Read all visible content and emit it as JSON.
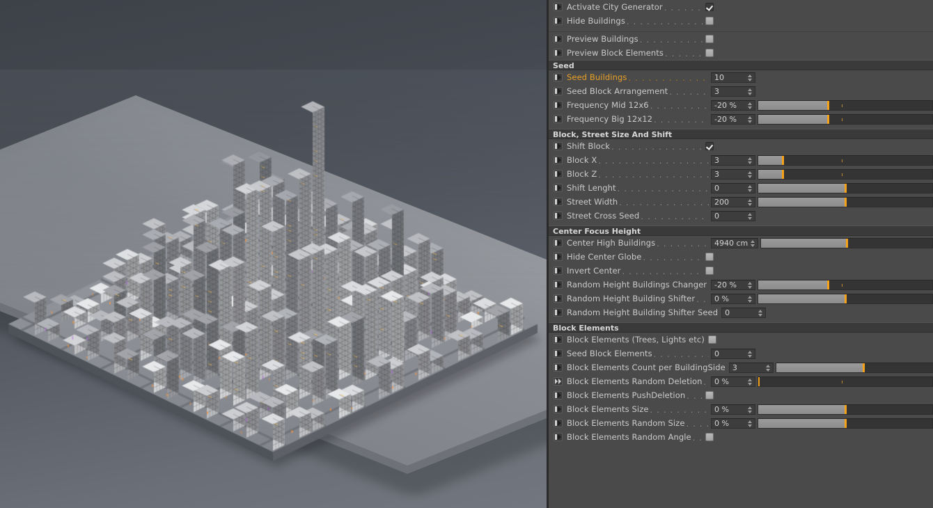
{
  "app": {
    "viewport_name": "3d-city-viewport"
  },
  "panel": {
    "groups": [
      {
        "type": "rows",
        "rows": [
          {
            "icon": "keyframe-icon",
            "label": "Activate City Generator",
            "dots": ". . . . . . . . . . . . .",
            "control": "checkbox",
            "value": "checked",
            "highlight": false
          },
          {
            "icon": "keyframe-icon",
            "label": "Hide Buildings",
            "dots": ". . . . . . . . . . . . . . . . . . .",
            "control": "checkbox",
            "value": "unchecked",
            "highlight": false
          }
        ]
      },
      {
        "type": "separator"
      },
      {
        "type": "rows",
        "rows": [
          {
            "icon": "keyframe-icon",
            "label": "Preview Buildings",
            "dots": ". . . . . . . . . . . . . . . .",
            "control": "checkbox",
            "value": "unchecked",
            "highlight": false
          },
          {
            "icon": "keyframe-icon",
            "label": "Preview Block Elements",
            "dots": ". . . . . . . . . . . . .",
            "control": "checkbox",
            "value": "unchecked",
            "highlight": false
          }
        ]
      },
      {
        "type": "section",
        "title": "Seed",
        "rows": [
          {
            "icon": "keyframe-icon",
            "label": "Seed Buildings",
            "dots": ". . . . . . . . . . . . . . . . . .",
            "control": "number",
            "value": "10",
            "highlight": true
          },
          {
            "icon": "keyframe-icon",
            "label": "Seed Block Arrangement",
            "dots": ". . . . . . . . . . . .",
            "control": "number",
            "value": "3",
            "highlight": false
          },
          {
            "icon": "keyframe-icon",
            "label": "Frequency Mid 12x6",
            "dots": ". . . . . . . . . . . . . . .",
            "control": "slider",
            "value": "-20 %",
            "fill_pct": 40,
            "tick_pct": 48,
            "highlight": false
          },
          {
            "icon": "keyframe-icon",
            "label": "Frequency Big 12x12",
            "dots": ". . . . . . . . . . . . . .",
            "control": "slider",
            "value": "-20 %",
            "fill_pct": 40,
            "tick_pct": 48,
            "highlight": false
          }
        ]
      },
      {
        "type": "section",
        "title": "Block, Street Size And Shift",
        "rows": [
          {
            "icon": "keyframe-icon",
            "label": "Shift Block",
            "dots": ". . . . . . . . . . . . . . . . . . . . . .",
            "control": "checkbox",
            "value": "checked",
            "highlight": false
          },
          {
            "icon": "keyframe-icon",
            "label": "Block X",
            "dots": ". . . . . . . . . . . . . . . . . . . . . . . .",
            "control": "slider",
            "value": "3",
            "fill_pct": 14,
            "tick_pct": 48,
            "highlight": false
          },
          {
            "icon": "keyframe-icon",
            "label": "Block Z",
            "dots": ". . . . . . . . . . . . . . . . . . . . . . . .",
            "control": "slider",
            "value": "3",
            "fill_pct": 14,
            "tick_pct": 48,
            "highlight": false
          },
          {
            "icon": "keyframe-icon",
            "label": "Shift Lenght",
            "dots": ". . . . . . . . . . . . . . . . . . . . .",
            "control": "slider",
            "value": "0",
            "fill_pct": 50,
            "tick_pct": -1,
            "highlight": false
          },
          {
            "icon": "keyframe-icon",
            "label": "Street Width",
            "dots": ". . . . . . . . . . . . . . . . . . . . .",
            "control": "slider",
            "value": "200",
            "fill_pct": 50,
            "tick_pct": -1,
            "highlight": false
          },
          {
            "icon": "keyframe-icon",
            "label": "Street Cross Seed",
            "dots": ". . . . . . . . . . . . . . . .",
            "control": "number",
            "value": "0",
            "highlight": false
          }
        ]
      },
      {
        "type": "section",
        "title": "Center Focus Height",
        "rows": [
          {
            "icon": "keyframe-icon",
            "label": "Center High Buildings",
            "dots": ". . . . . . . . . . . . . .",
            "control": "slider",
            "value": "4940 cm",
            "fill_pct": 50,
            "tick_pct": -1,
            "wide_value": true,
            "highlight": false
          },
          {
            "icon": "keyframe-icon",
            "label": "Hide Center Globe",
            "dots": ". . . . . . . . . . . . . . . .",
            "control": "checkbox",
            "value": "unchecked",
            "highlight": false
          },
          {
            "icon": "keyframe-icon",
            "label": "Invert Center",
            "dots": ". . . . . . . . . . . . . . . . . . . .",
            "control": "checkbox",
            "value": "unchecked",
            "highlight": false
          },
          {
            "icon": "keyframe-icon",
            "label": "Random Height Buildings Changer",
            "dots": ". . . .",
            "control": "slider",
            "value": "-20 %",
            "fill_pct": 40,
            "tick_pct": 48,
            "highlight": false
          },
          {
            "icon": "keyframe-icon",
            "label": "Random Height Building Shifter",
            "dots": ". . . . . .",
            "control": "slider",
            "value": "0 %",
            "fill_pct": 50,
            "tick_pct": -1,
            "highlight": false
          },
          {
            "icon": "keyframe-icon",
            "label": "Random Height Building Shifter Seed",
            "dots": "",
            "control": "number",
            "value": "0",
            "highlight": false
          }
        ]
      },
      {
        "type": "section",
        "title": "Block Elements",
        "rows": [
          {
            "icon": "keyframe-icon",
            "label": "Block Elements (Trees, Lights etc)",
            "dots": ". . . . . .",
            "control": "checkbox",
            "value": "unchecked",
            "highlight": false
          },
          {
            "icon": "keyframe-icon",
            "label": "Seed Block Elements",
            "dots": ". . . . . . . . . . . . . .",
            "control": "number",
            "value": "0",
            "highlight": false
          },
          {
            "icon": "keyframe-icon",
            "label": "Block Elements Count per BuildingSide",
            "dots": "",
            "control": "slider",
            "value": "3",
            "fill_pct": 50,
            "tick_pct": -1,
            "highlight": false
          },
          {
            "icon": "keyframe-anim-icon",
            "label": "Block Elements Random Deletion",
            "dots": ". . . . .",
            "control": "slider",
            "value": "0 %",
            "fill_pct": 0,
            "tick_pct": 48,
            "highlight": false
          },
          {
            "icon": "keyframe-icon",
            "label": "Block Elements PushDeletion",
            "dots": ". . . . . . . . .",
            "control": "checkbox",
            "value": "unchecked",
            "highlight": false
          },
          {
            "icon": "keyframe-icon",
            "label": "Block Elements Size",
            "dots": ". . . . . . . . . . . . . .",
            "control": "slider",
            "value": "0 %",
            "fill_pct": 50,
            "tick_pct": -1,
            "highlight": false
          },
          {
            "icon": "keyframe-icon",
            "label": "Block Elements Random Size",
            "dots": ". . . . . . . . .",
            "control": "slider",
            "value": "0 %",
            "fill_pct": 50,
            "tick_pct": -1,
            "highlight": false
          },
          {
            "icon": "keyframe-icon",
            "label": "Block Elements Random Angle",
            "dots": ". . . . . . . .",
            "control": "checkbox",
            "value": "unchecked",
            "highlight": false
          }
        ]
      }
    ]
  },
  "colors": {
    "panel_bg": "#4a4a4a",
    "section_bg": "#3a3a3a",
    "accent_orange": "#f5a11a",
    "label_highlight": "#e8a025",
    "text": "#cbcbcb",
    "field_bg": "#3d3d3d",
    "slider_fill": "#949494"
  }
}
